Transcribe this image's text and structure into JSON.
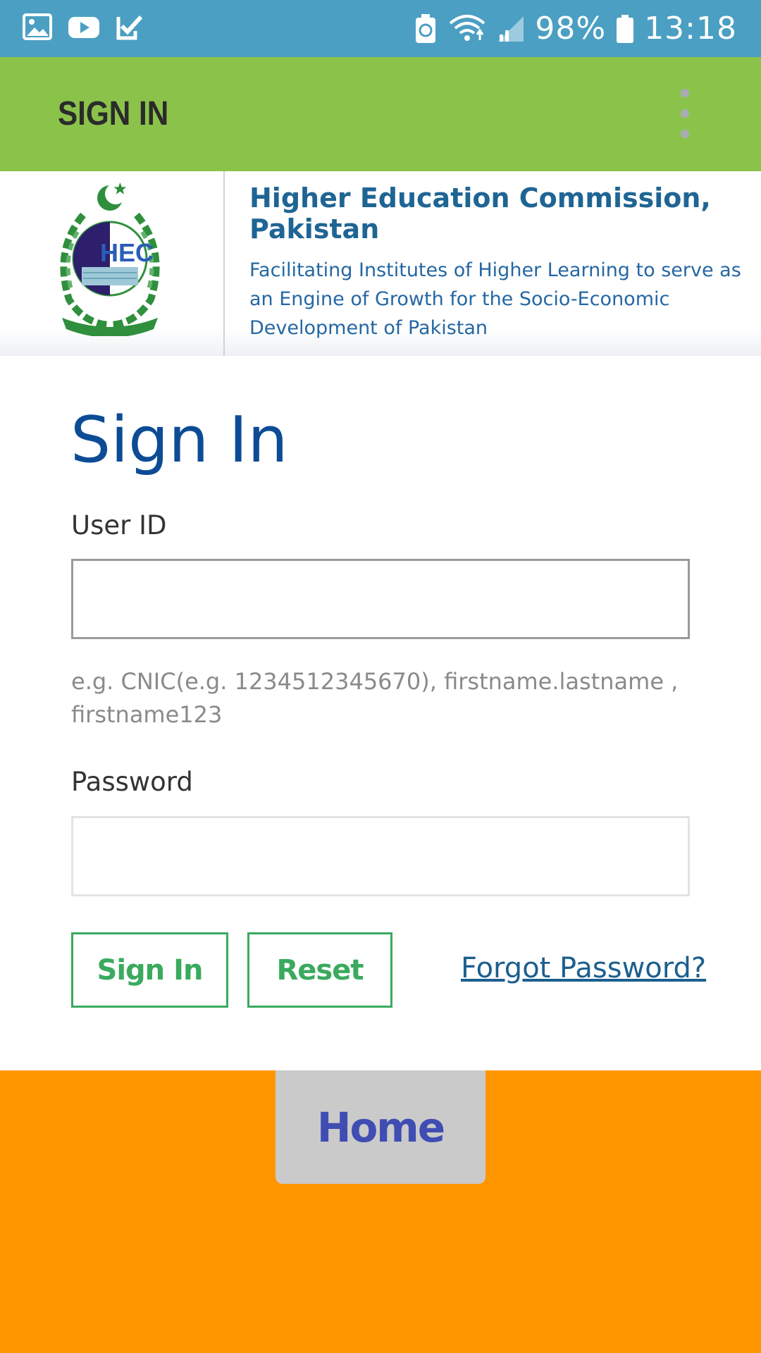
{
  "status_bar": {
    "battery_percent": "98%",
    "time": "13:18",
    "left_icons": [
      "gallery-icon",
      "youtube-icon",
      "task-check-icon"
    ],
    "right_icons": [
      "battery-saver-icon",
      "wifi-icon",
      "signal-icon",
      "battery-icon"
    ]
  },
  "app_bar": {
    "title": "SIGN IN",
    "menu_icon": "overflow-menu-icon"
  },
  "header": {
    "org_name": "Higher Education Commission, Pakistan",
    "tagline": "Facilitating Institutes of Higher Learning to serve as an Engine of Growth for the Socio-Economic Development of Pakistan",
    "logo_text": "HEC"
  },
  "form": {
    "heading": "Sign In",
    "user_id_label": "User ID",
    "user_id_value": "",
    "user_id_hint": "e.g. CNIC(e.g. 1234512345670), firstname.lastname , firstname123",
    "password_label": "Password",
    "password_value": "",
    "sign_in_button": "Sign In",
    "reset_button": "Reset",
    "forgot_link": "Forgot Password?"
  },
  "footer": {
    "home_button": "Home"
  },
  "colors": {
    "status_bar": "#4b9fc2",
    "app_bar": "#8bc34a",
    "heading": "#0d4c95",
    "button_accent": "#3aaa5e",
    "footer": "#ff9600",
    "home_text": "#3f4db3"
  }
}
